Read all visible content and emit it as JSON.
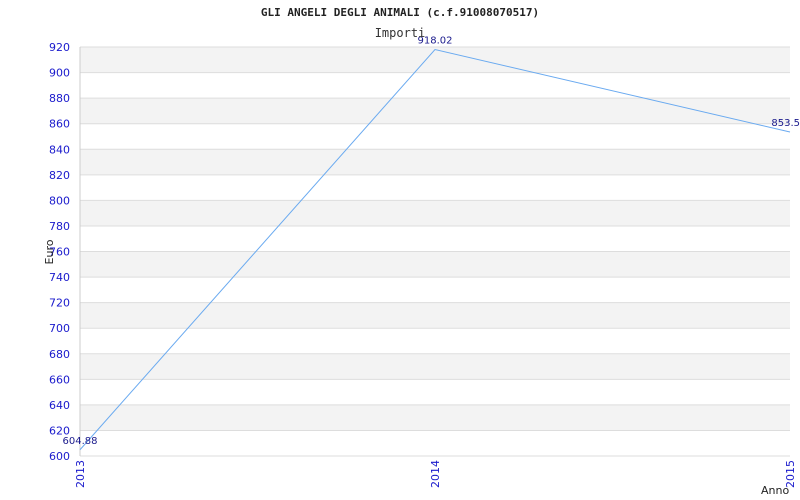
{
  "chart_data": {
    "type": "line",
    "title": "GLI ANGELI DEGLI ANIMALI (c.f.91008070517)",
    "subtitle": "Importi",
    "xlabel": "Anno",
    "ylabel": "Euro",
    "categories": [
      "2013",
      "2014",
      "2015"
    ],
    "series": [
      {
        "values": [
          604.88,
          918.02,
          853.5
        ]
      }
    ],
    "data_labels": [
      "604.88",
      "918.02",
      "853.5"
    ],
    "ylim": [
      600,
      920
    ],
    "yticks": [
      600,
      620,
      640,
      660,
      680,
      700,
      720,
      740,
      760,
      780,
      800,
      820,
      840,
      860,
      880,
      900,
      920
    ],
    "grid": true,
    "line_color": "#6aaaf0",
    "band_color": "#f3f3f3",
    "tick_color": "#1a1acc"
  }
}
